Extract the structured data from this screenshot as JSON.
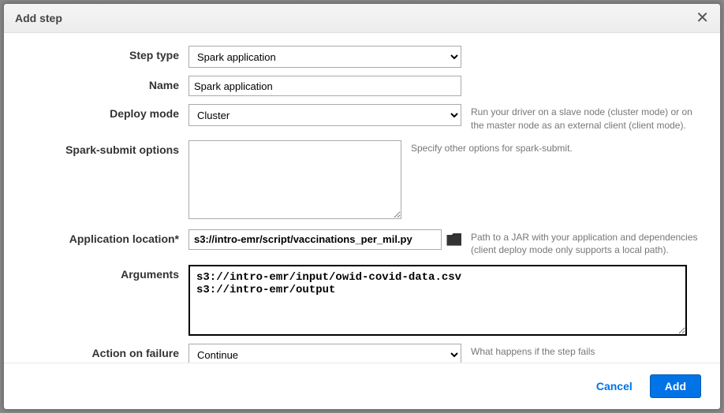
{
  "dialog": {
    "title": "Add step"
  },
  "labels": {
    "step_type": "Step type",
    "name": "Name",
    "deploy_mode": "Deploy mode",
    "spark_submit_options": "Spark-submit options",
    "application_location": "Application location*",
    "arguments": "Arguments",
    "action_on_failure": "Action on failure"
  },
  "fields": {
    "step_type": "Spark application",
    "name": "Spark application",
    "deploy_mode": "Cluster",
    "spark_submit_options": "",
    "application_location": "s3://intro-emr/script/vaccinations_per_mil.py",
    "arguments": "s3://intro-emr/input/owid-covid-data.csv\ns3://intro-emr/output",
    "action_on_failure": "Continue"
  },
  "help": {
    "deploy_mode": "Run your driver on a slave node (cluster mode) or on the master node as an external client (client mode).",
    "spark_submit_options": "Specify other options for spark-submit.",
    "application_location": "Path to a JAR with your application and dependencies (client deploy mode only supports a local path).",
    "action_on_failure": "What happens if the step fails"
  },
  "buttons": {
    "cancel": "Cancel",
    "add": "Add"
  }
}
